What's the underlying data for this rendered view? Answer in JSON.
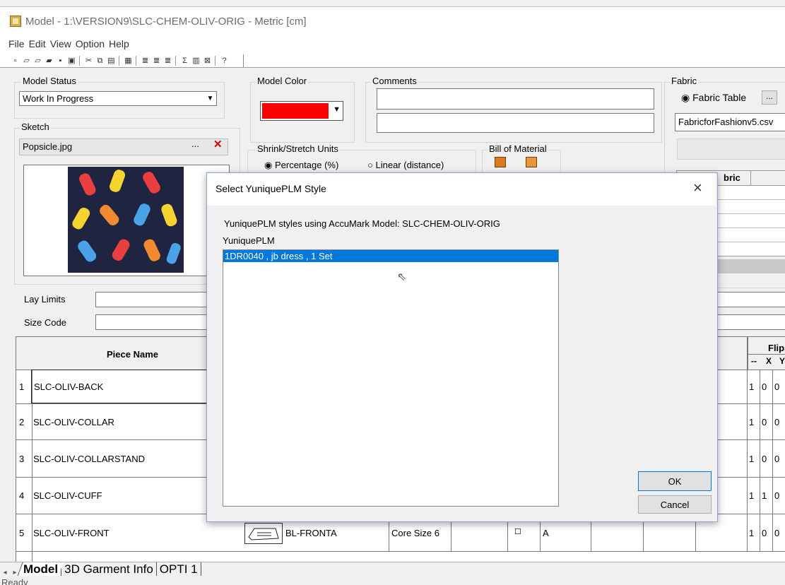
{
  "window": {
    "title": "Model - 1:\\VERSION9\\SLC-CHEM-OLIV-ORIG - Metric [cm]"
  },
  "menu": [
    "File",
    "Edit",
    "View",
    "Option",
    "Help"
  ],
  "model_status": {
    "label": "Model Status",
    "value": "Work In Progress"
  },
  "model_color": {
    "label": "Model Color",
    "color": "#ff0000"
  },
  "comments": {
    "label": "Comments"
  },
  "fabric": {
    "label": "Fabric",
    "radio_label": "Fabric Table",
    "ellipsis": "...",
    "file": "FabricforFashionv5.csv",
    "table_header": "bric"
  },
  "sketch": {
    "label": "Sketch",
    "file": "Popsicle.jpg",
    "ellipsis": "..."
  },
  "shrink": {
    "label": "Shrink/Stretch Units",
    "option1": "Percentage (%)",
    "option2": "Linear (distance)"
  },
  "bom": {
    "label": "Bill of Material"
  },
  "lay_limits": {
    "label": "Lay Limits"
  },
  "size_code": {
    "label": "Size Code"
  },
  "pieces": {
    "header": "Piece Name",
    "flips_header": "Flips",
    "flip_cols": [
      "--",
      "X",
      "Y"
    ],
    "rows": [
      {
        "num": "1",
        "name": "SLC-OLIV-BACK",
        "flips": [
          "1",
          "0",
          "0"
        ]
      },
      {
        "num": "2",
        "name": "SLC-OLIV-COLLAR",
        "flips": [
          "1",
          "0",
          "0"
        ]
      },
      {
        "num": "3",
        "name": "SLC-OLIV-COLLARSTAND",
        "flips": [
          "1",
          "0",
          "0"
        ]
      },
      {
        "num": "4",
        "name": "SLC-OLIV-CUFF",
        "flips": [
          "1",
          "1",
          "0"
        ]
      },
      {
        "num": "5",
        "name": "SLC-OLIV-FRONT",
        "flips": [
          "1",
          "0",
          "0"
        ],
        "piece": "BL-FRONTA",
        "size": "Core Size 6",
        "checkbox": "☐",
        "cat": "A"
      }
    ]
  },
  "tabs": [
    "Model",
    "3D Garment Info",
    "OPTI 1"
  ],
  "status": "Ready",
  "dialog": {
    "title": "Select YuniquePLM Style",
    "close": "×",
    "description": "YuniquePLM styles using AccuMark Model: SLC-CHEM-OLIV-ORIG",
    "list_label": "YuniquePLM",
    "items": [
      "1DR0040 , jb dress , 1 Set"
    ],
    "ok": "OK",
    "cancel": "Cancel"
  }
}
